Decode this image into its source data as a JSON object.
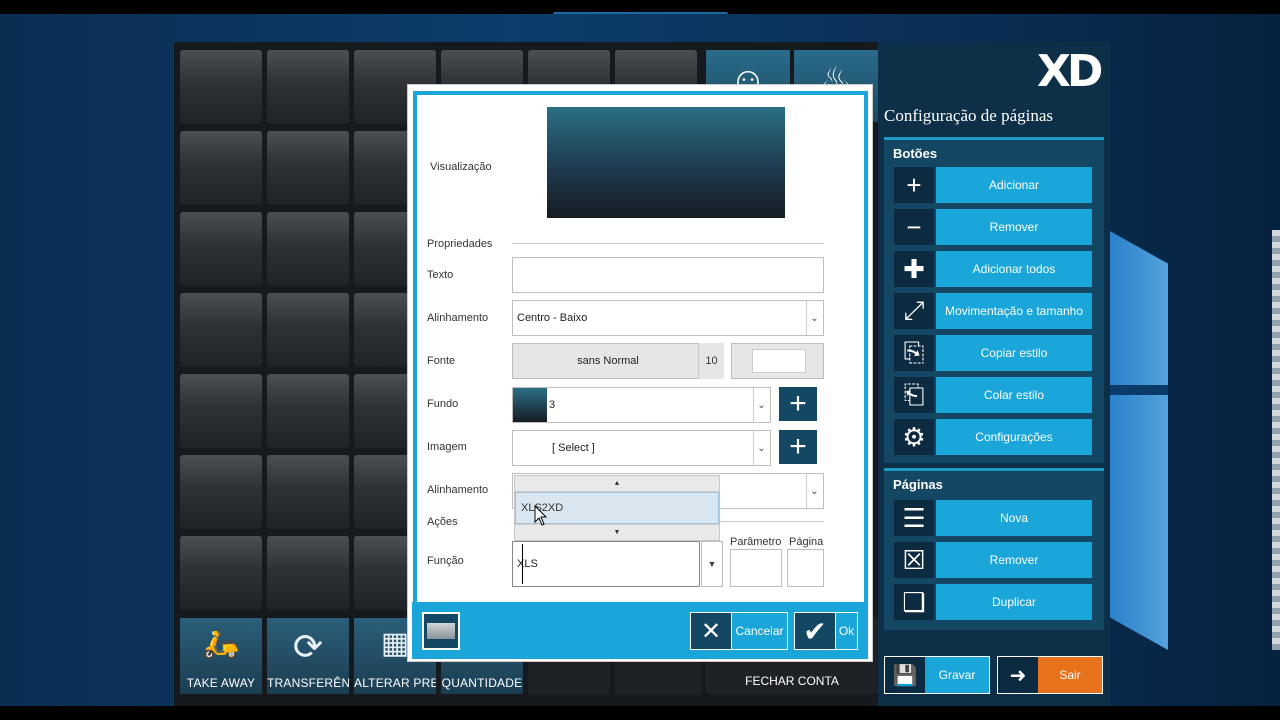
{
  "app": {
    "panel_title": "Configuração de páginas",
    "logo_text": "XD",
    "groups": {
      "botoes_title": "Botões",
      "paginas_title": "Páginas"
    },
    "botoes_actions": [
      {
        "label": "Adicionar",
        "icon": "plus-icon"
      },
      {
        "label": "Remover",
        "icon": "minus-icon"
      },
      {
        "label": "Adicionar todos",
        "icon": "add-all-icon"
      },
      {
        "label": "Movimentação e tamanho",
        "icon": "resize-icon"
      },
      {
        "label": "Copiar estilo",
        "icon": "copy-style-icon"
      },
      {
        "label": "Colar estilo",
        "icon": "paste-style-icon"
      },
      {
        "label": "Configurações",
        "icon": "gear-icon"
      }
    ],
    "paginas_actions": [
      {
        "label": "Nova",
        "icon": "new-page-icon"
      },
      {
        "label": "Remover",
        "icon": "remove-page-icon"
      },
      {
        "label": "Duplicar",
        "icon": "duplicate-page-icon"
      }
    ],
    "gravar_label": "Gravar",
    "sair_label": "Sair"
  },
  "bottom_nav": [
    {
      "label": "TAKE AWAY",
      "icon": "scooter-icon"
    },
    {
      "label": "TRANSFERÊNC",
      "icon": "transfer-arrows-icon"
    },
    {
      "label": "ALTERAR PREÇ",
      "icon": "calculator-icon"
    },
    {
      "label": "QUANTIDADE",
      "icon": "quantity-icon"
    },
    {
      "label": "FECHAR CONTA",
      "icon": ""
    }
  ],
  "dialog": {
    "visualizacao_label": "Visualização",
    "propriedades_label": "Propriedades",
    "texto_label": "Texto",
    "texto_value": "",
    "alinhamento_label": "Alinhamento",
    "alinhamento_value": "Centro - Baixo",
    "fonte_label": "Fonte",
    "fonte_value": "sans Normal",
    "fonte_size": "10",
    "fundo_label": "Fundo",
    "fundo_value": "3",
    "imagem_label": "Imagem",
    "imagem_value": "[ Select ]",
    "alinhamento2_label": "Alinhamento",
    "acoes_label": "Ações",
    "funcao_label": "Função",
    "funcao_value": "XLS",
    "parametro_label": "Parâmetro",
    "pagina_label": "Página",
    "popup_item": "XLS2XD",
    "cancelar_label": "Cancelar",
    "ok_label": "Ok"
  },
  "colors": {
    "accent": "#1ba6d9",
    "dark_blue": "#134764",
    "orange": "#e8711c"
  }
}
